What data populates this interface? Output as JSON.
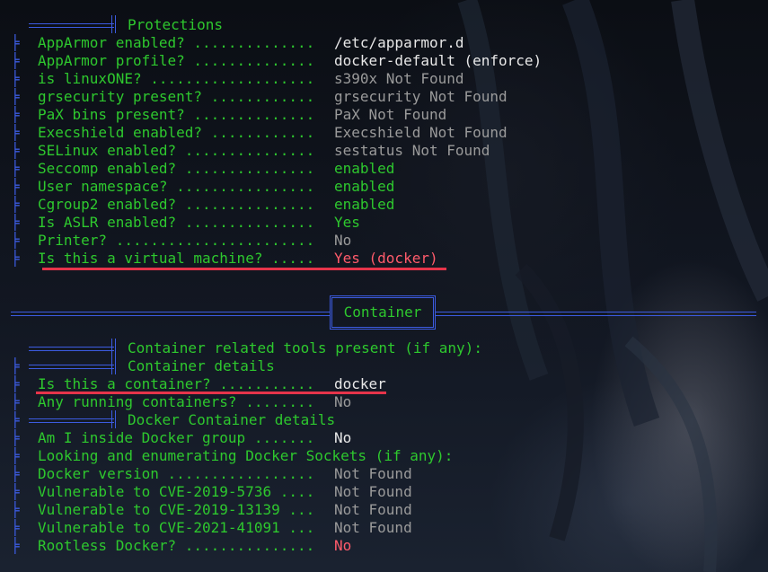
{
  "protections": {
    "title": "Protections",
    "rows": [
      {
        "label": "AppArmor enabled? ..............",
        "value": "/etc/apparmor.d"
      },
      {
        "label": "AppArmor profile? ..............",
        "value": "docker-default (enforce)"
      },
      {
        "label": "is linuxONE? ...................",
        "value": "s390x Not Found"
      },
      {
        "label": "grsecurity present? ............",
        "value": "grsecurity Not Found"
      },
      {
        "label": "PaX bins present? ..............",
        "value": "PaX Not Found"
      },
      {
        "label": "Execshield enabled? ............",
        "value": "Execshield Not Found"
      },
      {
        "label": "SELinux enabled? ...............",
        "value": "sestatus Not Found"
      },
      {
        "label": "Seccomp enabled? ...............",
        "value": "enabled"
      },
      {
        "label": "User namespace? ................",
        "value": "enabled"
      },
      {
        "label": "Cgroup2 enabled? ...............",
        "value": "enabled"
      },
      {
        "label": "Is ASLR enabled? ...............",
        "value": "Yes"
      },
      {
        "label": "Printer? .......................",
        "value": "No"
      },
      {
        "label": "Is this a virtual machine? .....",
        "value": "Yes (docker)"
      }
    ]
  },
  "container_box": "Container",
  "container": {
    "tools_header": "Container related tools present (if any):",
    "details_header": "Container details",
    "rows": [
      {
        "label": "Is this a container? ...........",
        "value": "docker"
      },
      {
        "label": "Any running containers? ........",
        "value": "No"
      }
    ],
    "docker_header": "Docker Container details",
    "docker_rows": [
      {
        "label": "Am I inside Docker group .......",
        "value": "No"
      },
      {
        "label": "Looking and enumerating Docker Sockets (if any):",
        "value": ""
      },
      {
        "label": "Docker version .................",
        "value": "Not Found"
      },
      {
        "label": "Vulnerable to CVE-2019-5736 ....",
        "value": "Not Found"
      },
      {
        "label": "Vulnerable to CVE-2019-13139 ...",
        "value": "Not Found"
      },
      {
        "label": "Vulnerable to CVE-2021-41091 ...",
        "value": "Not Found"
      },
      {
        "label": "Rootless Docker? ...............",
        "value": "No"
      }
    ]
  },
  "colors": {
    "green": "#2ec82e",
    "blue": "#3c5be0",
    "red": "#ff5b6b",
    "underline": "#e6344a"
  }
}
